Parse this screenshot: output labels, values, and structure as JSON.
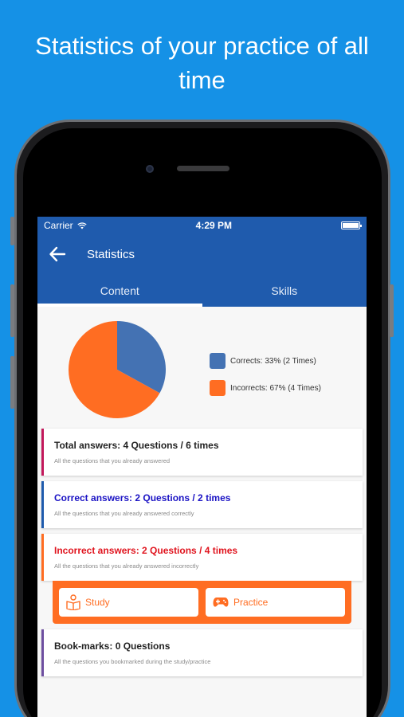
{
  "headline": "Statistics of your practice of all time",
  "status_bar": {
    "carrier": "Carrier",
    "time": "4:29 PM"
  },
  "header": {
    "title": "Statistics"
  },
  "tabs": [
    {
      "label": "Content",
      "active": true
    },
    {
      "label": "Skills",
      "active": false
    }
  ],
  "chart_data": {
    "type": "pie",
    "slices": [
      {
        "label": "Corrects: 33% (2 Times)",
        "value": 33,
        "count": 2,
        "color": "#4472b3"
      },
      {
        "label": "Incorrects: 67% (4 Times)",
        "value": 67,
        "count": 4,
        "color": "#ff6d22"
      }
    ],
    "legend_placement": "right"
  },
  "cards": {
    "total": {
      "title": "Total answers: 4 Questions / 6 times",
      "subtitle": "All the questions that you already answered"
    },
    "correct": {
      "title": "Correct answers: 2 Questions / 2 times",
      "subtitle": "All the questions that you already answered correctly"
    },
    "incorrect": {
      "title": "Incorrect answers: 2 Questions / 4 times",
      "subtitle": "All the questions that you already answered incorrectly"
    },
    "bookmarks": {
      "title": "Book-marks: 0 Questions",
      "subtitle": "All the questions you bookmarked during the study/practice"
    }
  },
  "actions": {
    "study_label": "Study",
    "practice_label": "Practice"
  },
  "colors": {
    "background": "#1591e6",
    "appbar": "#1f5bad",
    "accent": "#ff6d22",
    "correct_slice": "#4472b3"
  },
  "icons": [
    "wifi-icon",
    "battery-icon",
    "back-arrow-icon",
    "book-icon",
    "gamepad-icon"
  ]
}
